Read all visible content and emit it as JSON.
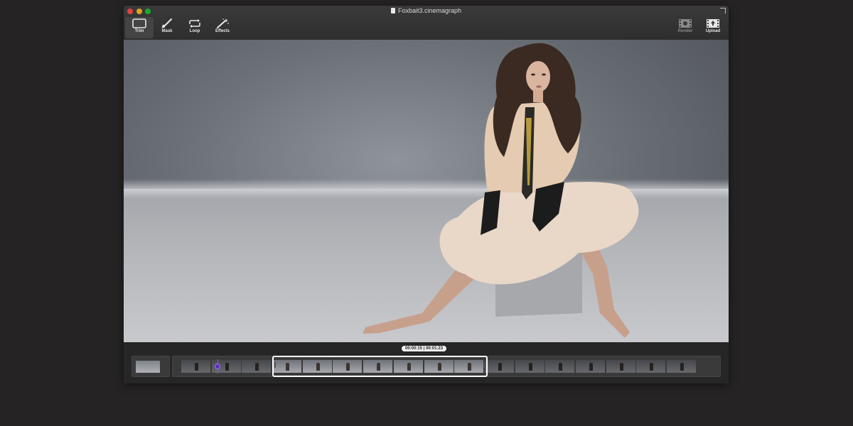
{
  "window": {
    "title": "Foxbait3.cinemagraph"
  },
  "toolbar": {
    "trim_label": "Trim",
    "mask_label": "Mask",
    "loop_label": "Loop",
    "effects_label": "Effects",
    "render_label": "Render",
    "upload_label": "Upload",
    "active_tool": "Trim"
  },
  "timeline": {
    "time_start": "00:00:15",
    "time_separator": "|",
    "time_end": "00:01:23"
  },
  "colors": {
    "accent_playhead": "#8a4fff",
    "selection_border": "#ffffff",
    "close": "#e0443e",
    "minimize": "#dea123",
    "maximize": "#1aab29"
  }
}
